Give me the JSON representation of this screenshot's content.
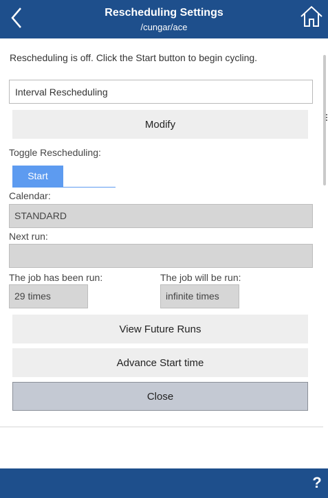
{
  "header": {
    "title": "Rescheduling Settings",
    "subtitle": "/cungar/ace",
    "back_icon": "chevron-left-icon",
    "home_icon": "home-icon"
  },
  "status_message": "Rescheduling is off. Click the Start button to begin cycling.",
  "schedule_name": {
    "value": "Interval Rescheduling"
  },
  "modify_button": "Modify",
  "toggle": {
    "label": "Toggle Rescheduling:",
    "state_label": "Start",
    "active_color": "#5d9bf0"
  },
  "calendar": {
    "label": "Calendar:",
    "value": "STANDARD"
  },
  "next_run": {
    "label": "Next run:",
    "value": ""
  },
  "job_run": {
    "label": "The job has been run:",
    "value": "29 times"
  },
  "job_will_run": {
    "label": "The job will be run:",
    "value": "infinite times"
  },
  "view_future_runs_button": "View Future Runs",
  "advance_start_button": "Advance Start time",
  "close_button": "Close",
  "footer": {
    "help_label": "?"
  },
  "colors": {
    "header_bg": "#1e4f8c",
    "readonly_bg": "#d6d6d6",
    "button_bg": "#eeeeee",
    "close_bg": "#c4c9d3"
  }
}
